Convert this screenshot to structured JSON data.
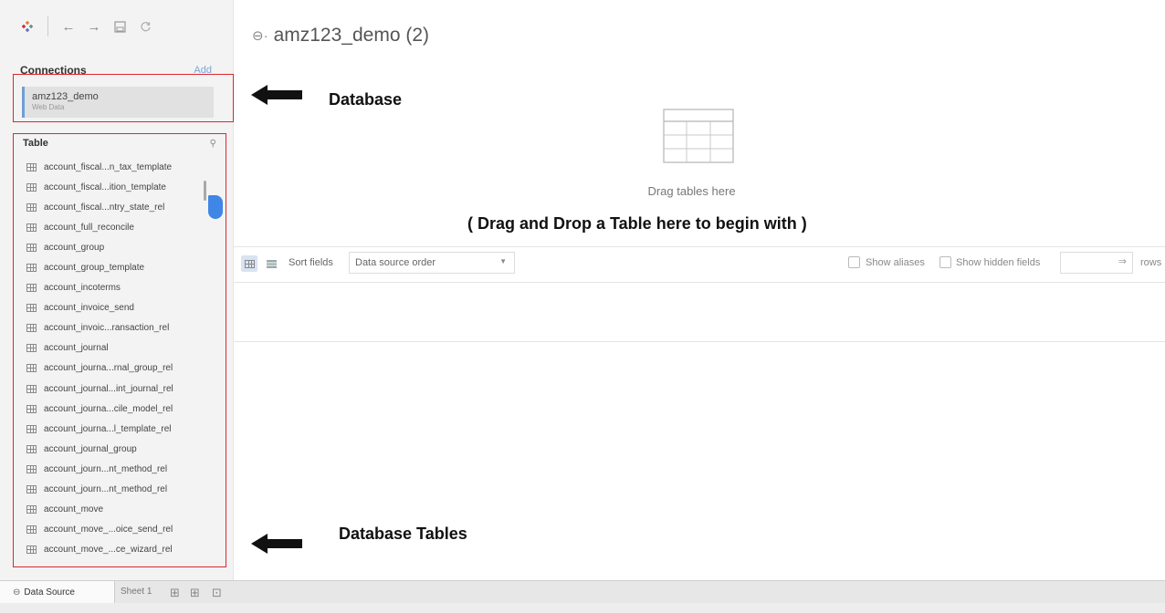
{
  "connections": {
    "title": "Connections",
    "add_label": "Add",
    "items": [
      {
        "name": "amz123_demo",
        "type": "Web Data"
      }
    ]
  },
  "tables": {
    "title": "Table",
    "items": [
      "account_fiscal...n_tax_template",
      "account_fiscal...ition_template",
      "account_fiscal...ntry_state_rel",
      "account_full_reconcile",
      "account_group",
      "account_group_template",
      "account_incoterms",
      "account_invoice_send",
      "account_invoic...ransaction_rel",
      "account_journal",
      "account_journa...rnal_group_rel",
      "account_journal...int_journal_rel",
      "account_journa...cile_model_rel",
      "account_journa...l_template_rel",
      "account_journal_group",
      "account_journ...nt_method_rel",
      "account_journ...nt_method_rel",
      "account_move",
      "account_move_...oice_send_rel",
      "account_move_...ce_wizard_rel"
    ]
  },
  "datasource": {
    "title": "amz123_demo (2)",
    "drop_hint": "Drag tables here"
  },
  "annotations": {
    "database": "Database",
    "database_tables": "Database Tables",
    "drop_instruction": "( Drag and Drop a Table here to begin with )"
  },
  "fields_bar": {
    "sort_label": "Sort fields",
    "sort_value": "Data source order",
    "show_aliases": "Show aliases",
    "show_hidden": "Show hidden fields",
    "rows_label": "rows"
  },
  "tabs": {
    "data_source": "Data Source",
    "sheet": "Sheet 1"
  },
  "colors": {
    "annotation_box": "#e0262d",
    "accent": "#3f86e6",
    "connection_marker": "#6f9ed7"
  }
}
